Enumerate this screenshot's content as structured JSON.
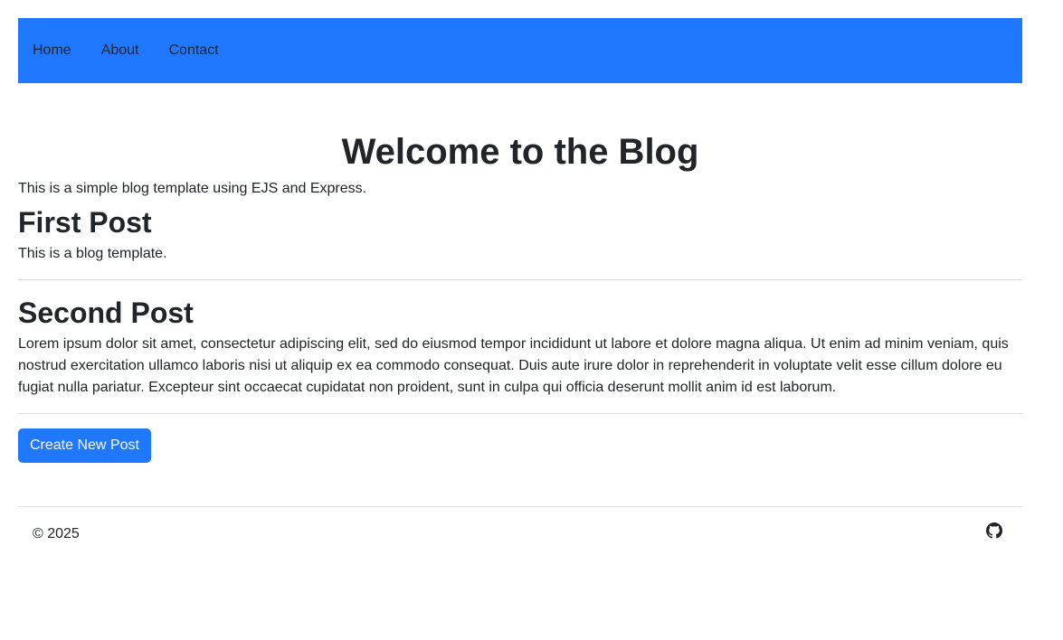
{
  "nav": {
    "items": [
      {
        "label": "Home"
      },
      {
        "label": "About"
      },
      {
        "label": "Contact"
      }
    ]
  },
  "main": {
    "title": "Welcome to the Blog",
    "intro": "This is a simple blog template using EJS and Express.",
    "posts": [
      {
        "title": "First Post",
        "body": "This is a blog template."
      },
      {
        "title": "Second Post",
        "body": "Lorem ipsum dolor sit amet, consectetur adipiscing elit, sed do eiusmod tempor incididunt ut labore et dolore magna aliqua. Ut enim ad minim veniam, quis nostrud exercitation ullamco laboris nisi ut aliquip ex ea commodo consequat. Duis aute irure dolor in reprehenderit in voluptate velit esse cillum dolore eu fugiat nulla pariatur. Excepteur sint occaecat cupidatat non proident, sunt in culpa qui officia deserunt mollit anim id est laborum."
      }
    ],
    "create_button_label": "Create New Post"
  },
  "footer": {
    "copyright": "© 2025",
    "icon": "github-icon"
  },
  "colors": {
    "navbar_bg": "#1f78fd",
    "button_bg": "#1f78fd",
    "text": "#212529",
    "divider": "#dcdee0"
  }
}
